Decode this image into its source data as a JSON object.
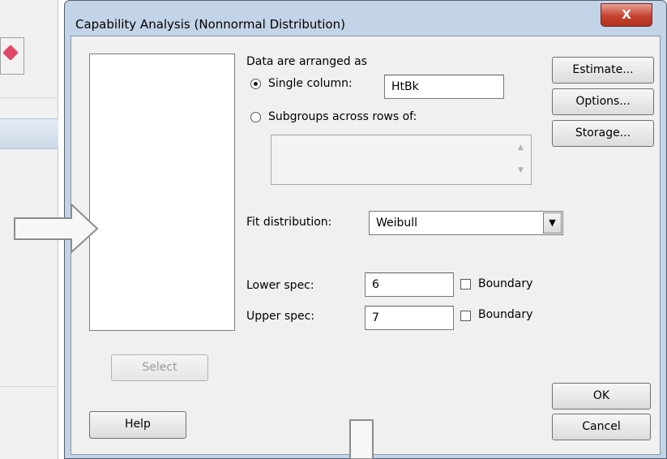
{
  "dialog": {
    "title": "Capability Analysis (Nonnormal Distribution)",
    "close_label": "X"
  },
  "data_arrangement": {
    "heading": "Data are arranged as",
    "single_column_label": "Single column:",
    "single_column_value": "HtBk",
    "single_column_selected": true,
    "subgroups_label": "Subgroups across rows of:",
    "subgroups_selected": false,
    "subgroups_value": ""
  },
  "fit_distribution": {
    "label": "Fit distribution:",
    "selected": "Weibull"
  },
  "specs": {
    "lower_label": "Lower spec:",
    "lower_value": "6",
    "lower_boundary_label": "Boundary",
    "lower_boundary_checked": false,
    "upper_label": "Upper spec:",
    "upper_value": "7",
    "upper_boundary_label": "Boundary",
    "upper_boundary_checked": false
  },
  "buttons": {
    "estimate": "Estimate...",
    "options": "Options...",
    "storage": "Storage...",
    "select": "Select",
    "help": "Help",
    "ok": "OK",
    "cancel": "Cancel"
  },
  "colors": {
    "title_bar": "#c3d4e8",
    "close_button": "#c4432f",
    "dialog_client": "#f0f0f0"
  }
}
